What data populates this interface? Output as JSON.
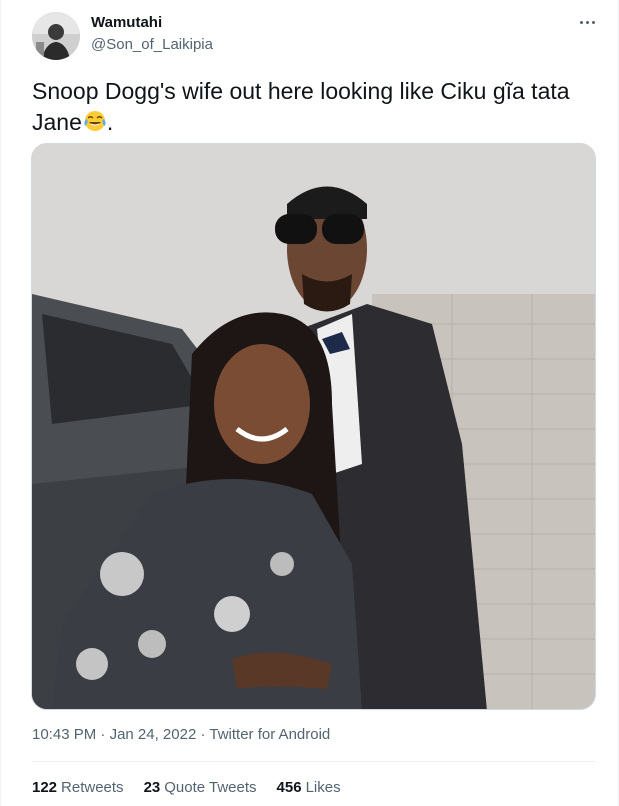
{
  "author": {
    "name": "Wamutahi",
    "handle": "@Son_of_Laikipia",
    "avatar_icon": "profile-avatar"
  },
  "menu": {
    "icon": "more-horizontal-icon"
  },
  "tweet": {
    "text": "Snoop Dogg's wife out here looking like Ciku gĩa tata Jane",
    "emoji": "face-with-tears-of-joy",
    "trailing": "."
  },
  "media": {
    "kind": "photo"
  },
  "meta": {
    "time": "10:43 PM",
    "date": "Jan 24, 2022",
    "separator": " · ",
    "source": "Twitter for Android"
  },
  "stats": {
    "retweets_count": "122",
    "retweets_label": "Retweets",
    "quotes_count": "23",
    "quotes_label": "Quote Tweets",
    "likes_count": "456",
    "likes_label": "Likes"
  },
  "colors": {
    "text_primary": "#0f1419",
    "text_secondary": "#536471",
    "border": "#eff3f4"
  }
}
